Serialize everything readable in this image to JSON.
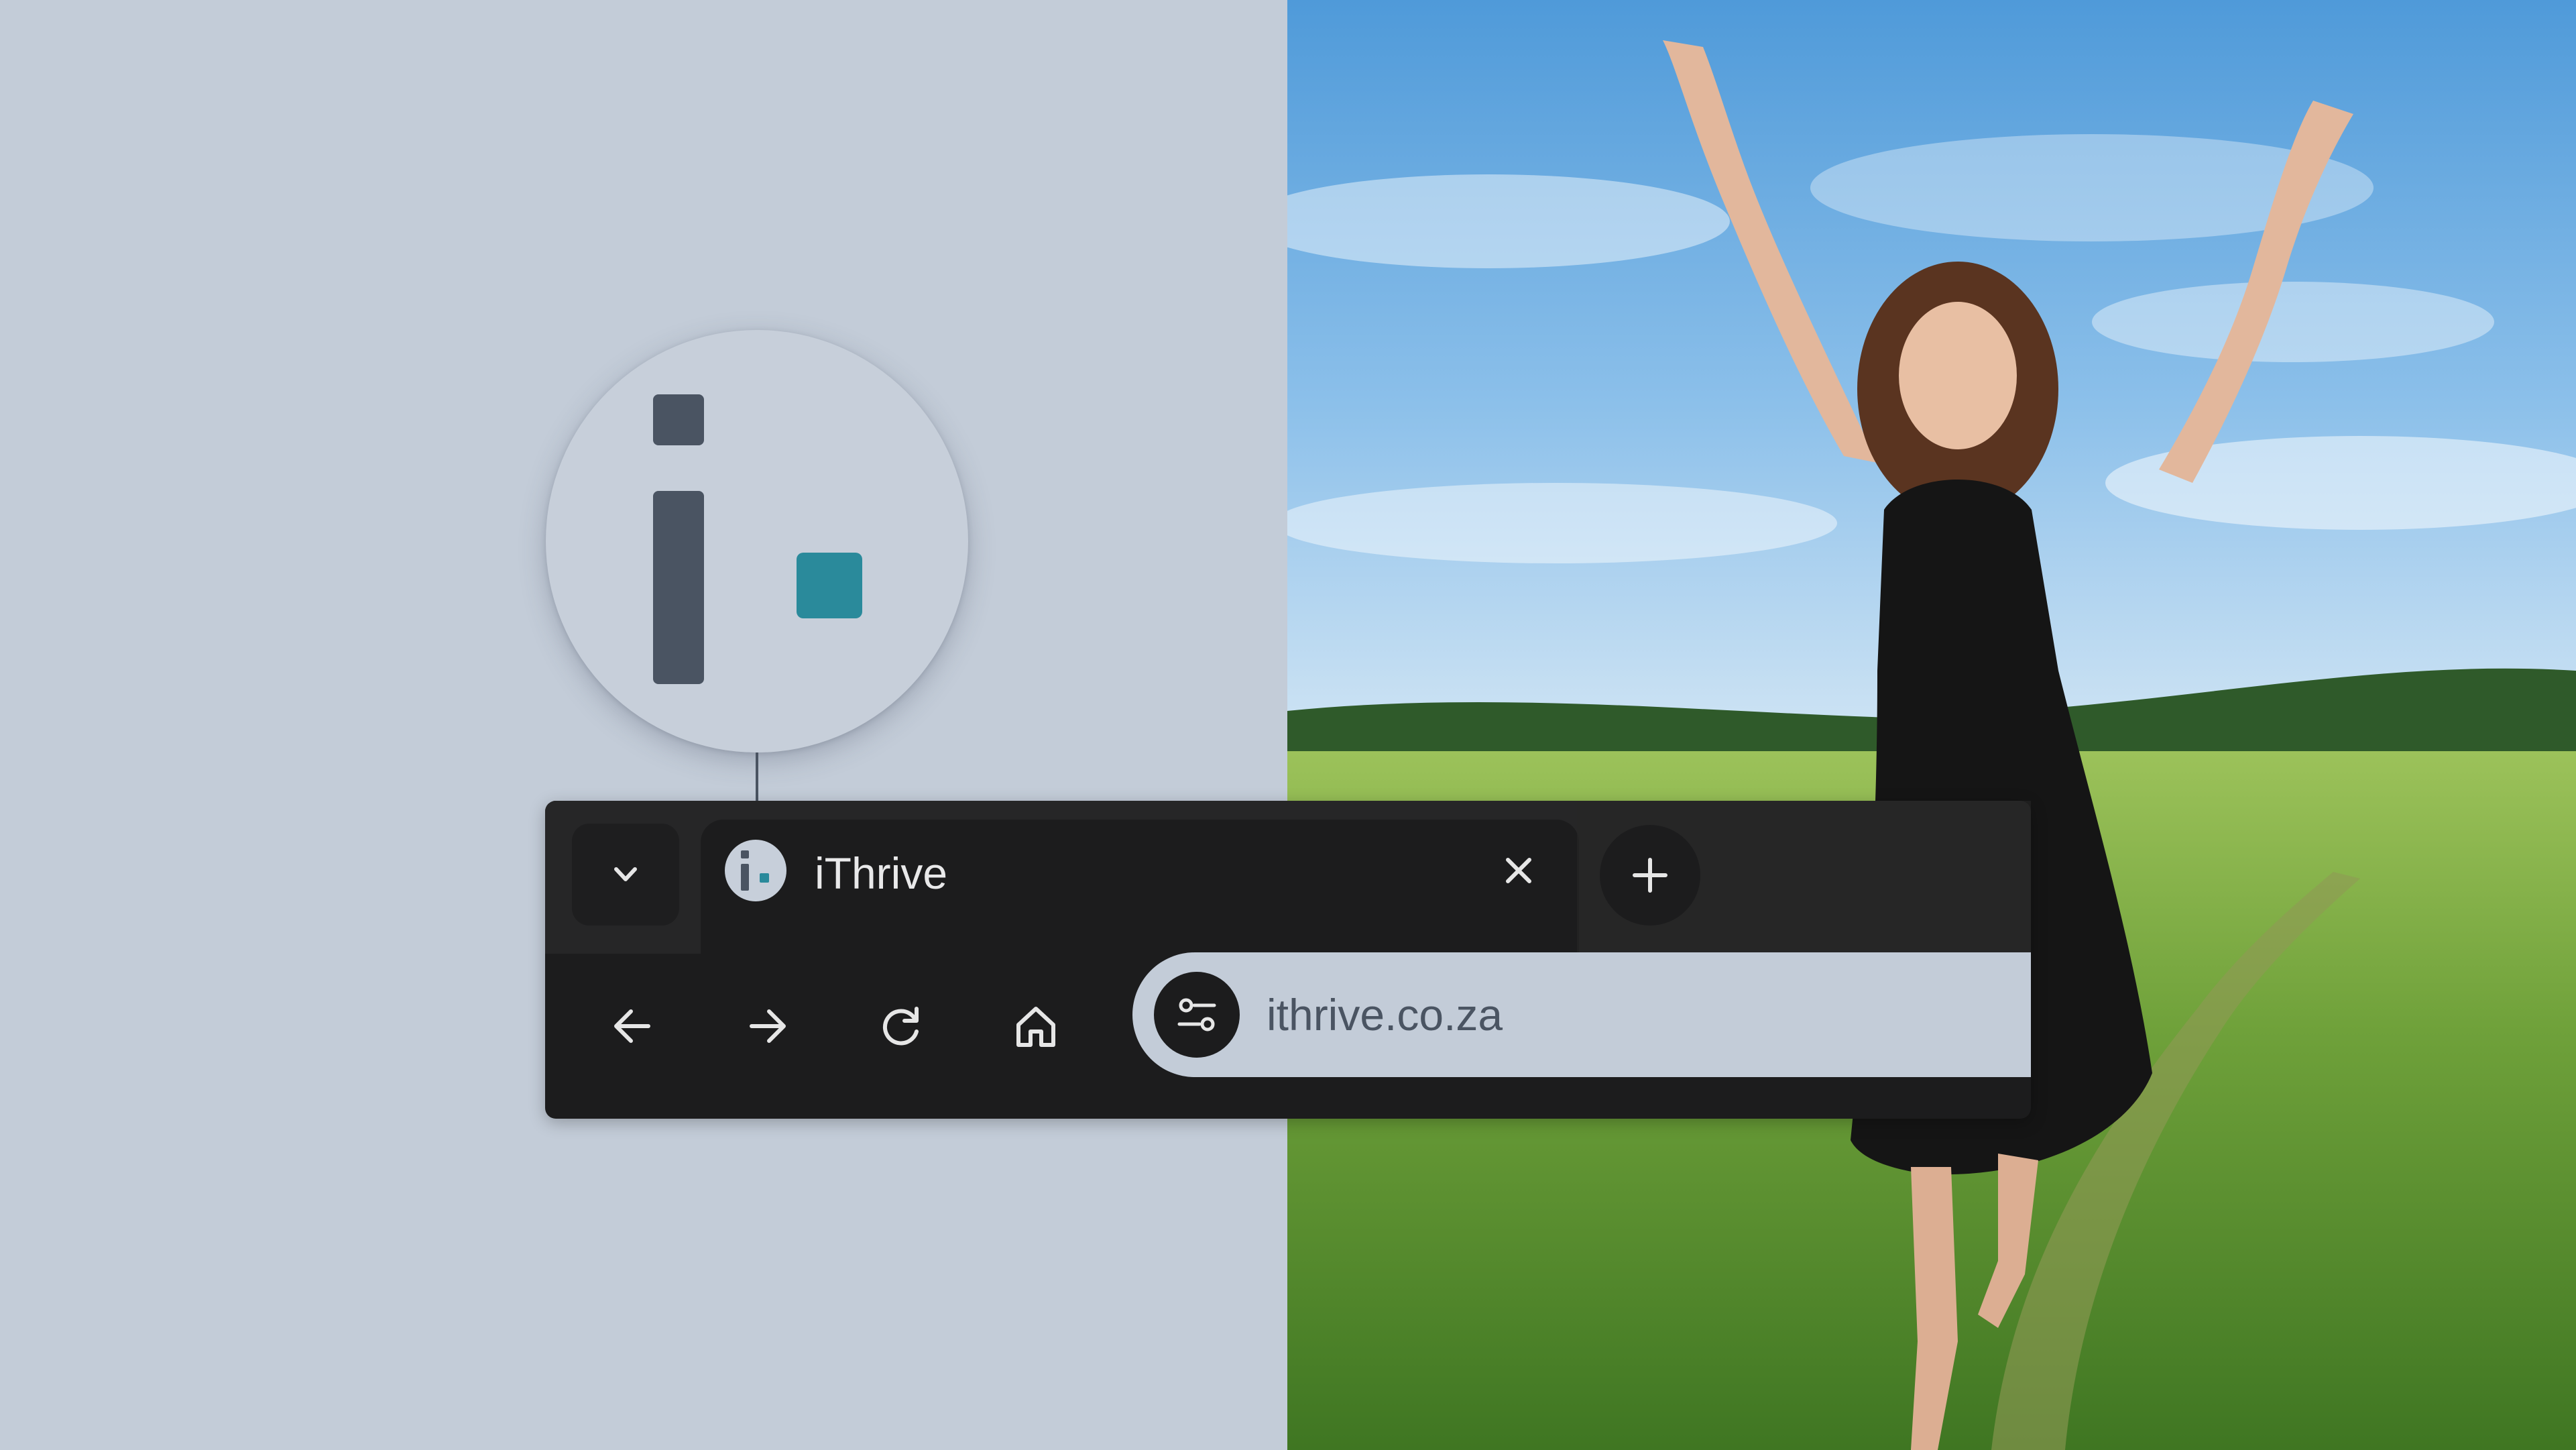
{
  "colors": {
    "background": "#c3ccd8",
    "chrome_dark": "#1c1c1d",
    "logo_dark": "#4a5462",
    "logo_teal": "#2a8a9b"
  },
  "logo": {
    "mark": "i.",
    "dot_color": "#2a8a9b",
    "stem_color": "#4a5462"
  },
  "tab_strip": {
    "tab_search_icon": "chevron-down-icon",
    "active_tab": {
      "favicon_icon": "ithrive-favicon-icon",
      "title": "iThrive",
      "close_icon": "close-icon"
    },
    "new_tab_icon": "plus-icon"
  },
  "toolbar": {
    "back_icon": "arrow-left-icon",
    "forward_icon": "arrow-right-icon",
    "reload_icon": "reload-icon",
    "home_icon": "home-icon",
    "site_info_icon": "tune-icon",
    "url": "ithrive.co.za"
  },
  "hero_image": {
    "icon": "woman-in-field-photo"
  }
}
